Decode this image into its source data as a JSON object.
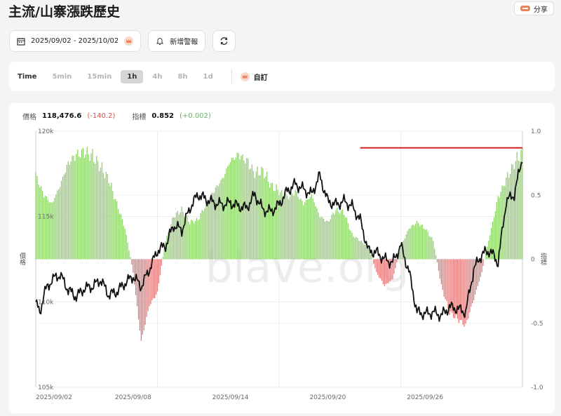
{
  "header": {
    "title": "主流/山寨漲跌歷史",
    "share_label": "分享"
  },
  "controls": {
    "date_range": "2025/09/02 - 2025/10/02",
    "alert_label": "新增警報"
  },
  "timeframes": {
    "label": "Time",
    "options": [
      "5min",
      "15min",
      "1h",
      "4h",
      "8h",
      "1d"
    ],
    "active": "1h",
    "custom_label": "自訂"
  },
  "legend": {
    "price_label": "價格",
    "price_value": "118,476.6",
    "price_change": "(-140.2)",
    "index_label": "指標",
    "index_value": "0.852",
    "index_change": "(+0.002)"
  },
  "axes": {
    "left_title": "價格",
    "right_title": "指標"
  },
  "watermark": "blave.org",
  "colors": {
    "positive": "#8fd16a",
    "negative": "#e47a7a",
    "price_line": "#111111",
    "threshold": "#d62020"
  },
  "chart_data": {
    "type": "bar",
    "x_ticks": [
      "2025/09/02",
      "2025/09/08",
      "2025/09/14",
      "2025/09/20",
      "2025/09/26"
    ],
    "x_range": [
      "2025/09/02",
      "2025/10/02"
    ],
    "left_axis": {
      "ticks": [
        "120k",
        "115k",
        "110k",
        "105k"
      ],
      "range": [
        105000,
        120000
      ]
    },
    "right_axis": {
      "ticks": [
        "1.0",
        "0.5",
        "0",
        "-0.5",
        "-1.0"
      ],
      "range": [
        -1.0,
        1.0
      ]
    },
    "threshold_line": {
      "value": 0.87,
      "from_day": 20,
      "to_day": 30
    },
    "series": [
      {
        "name": "指標",
        "type": "bar",
        "x": [
          0,
          0.5,
          1,
          1.5,
          2,
          2.5,
          3,
          3.5,
          4,
          4.5,
          5,
          5.5,
          6,
          6.5,
          7,
          7.5,
          8,
          8.5,
          9,
          9.5,
          10,
          10.5,
          11,
          11.5,
          12,
          12.5,
          13,
          13.5,
          14,
          14.5,
          15,
          15.5,
          16,
          16.5,
          17,
          17.5,
          18,
          18.5,
          19,
          19.5,
          20,
          20.5,
          21,
          21.5,
          22,
          22.5,
          23,
          23.5,
          24,
          24.5,
          25,
          25.5,
          26,
          26.5,
          27,
          27.5,
          28,
          28.5,
          29,
          29.5,
          30
        ],
        "values": [
          0.68,
          0.52,
          0.45,
          0.6,
          0.78,
          0.85,
          0.87,
          0.84,
          0.75,
          0.65,
          0.45,
          0.25,
          -0.1,
          -0.62,
          -0.35,
          -0.25,
          0.15,
          0.35,
          0.4,
          0.3,
          0.32,
          0.45,
          0.56,
          0.65,
          0.8,
          0.85,
          0.8,
          0.7,
          0.72,
          0.6,
          0.55,
          0.5,
          0.55,
          0.45,
          0.52,
          0.35,
          0.3,
          0.4,
          0.38,
          0.2,
          0.15,
          0.1,
          -0.1,
          -0.2,
          -0.15,
          0.1,
          0.25,
          0.3,
          0.25,
          0.15,
          -0.2,
          -0.4,
          -0.45,
          -0.5,
          -0.3,
          -0.1,
          0.2,
          0.5,
          0.65,
          0.78,
          0.87
        ]
      },
      {
        "name": "價格",
        "type": "line",
        "x": [
          0,
          0.25,
          0.5,
          1,
          1.5,
          2,
          2.5,
          3,
          3.5,
          4,
          4.5,
          5,
          5.5,
          6,
          6.5,
          7,
          7.5,
          8,
          8.5,
          9,
          9.5,
          10,
          10.5,
          11,
          11.5,
          12,
          12.5,
          13,
          13.5,
          14,
          14.5,
          15,
          15.5,
          16,
          16.5,
          17,
          17.5,
          18,
          18.5,
          19,
          19.5,
          20,
          20.5,
          21,
          21.5,
          22,
          22.5,
          23,
          23.5,
          24,
          24.5,
          25,
          25.5,
          26,
          26.5,
          27,
          27.5,
          28,
          28.5,
          29,
          29.5,
          30
        ],
        "values": [
          110000,
          109300,
          110500,
          111300,
          111600,
          110700,
          110300,
          110800,
          110900,
          111300,
          110400,
          110600,
          111100,
          111500,
          110900,
          111900,
          113000,
          113300,
          114500,
          114200,
          115500,
          116300,
          116000,
          115800,
          115700,
          115800,
          115600,
          115500,
          116300,
          115400,
          115300,
          115700,
          116500,
          116900,
          116600,
          116300,
          117400,
          115900,
          115700,
          115900,
          115600,
          114800,
          113000,
          112900,
          112500,
          112300,
          113300,
          111800,
          109400,
          109300,
          109400,
          109200,
          109700,
          109600,
          109400,
          111900,
          112800,
          113000,
          112300,
          115900,
          116300,
          118500
        ]
      }
    ]
  }
}
